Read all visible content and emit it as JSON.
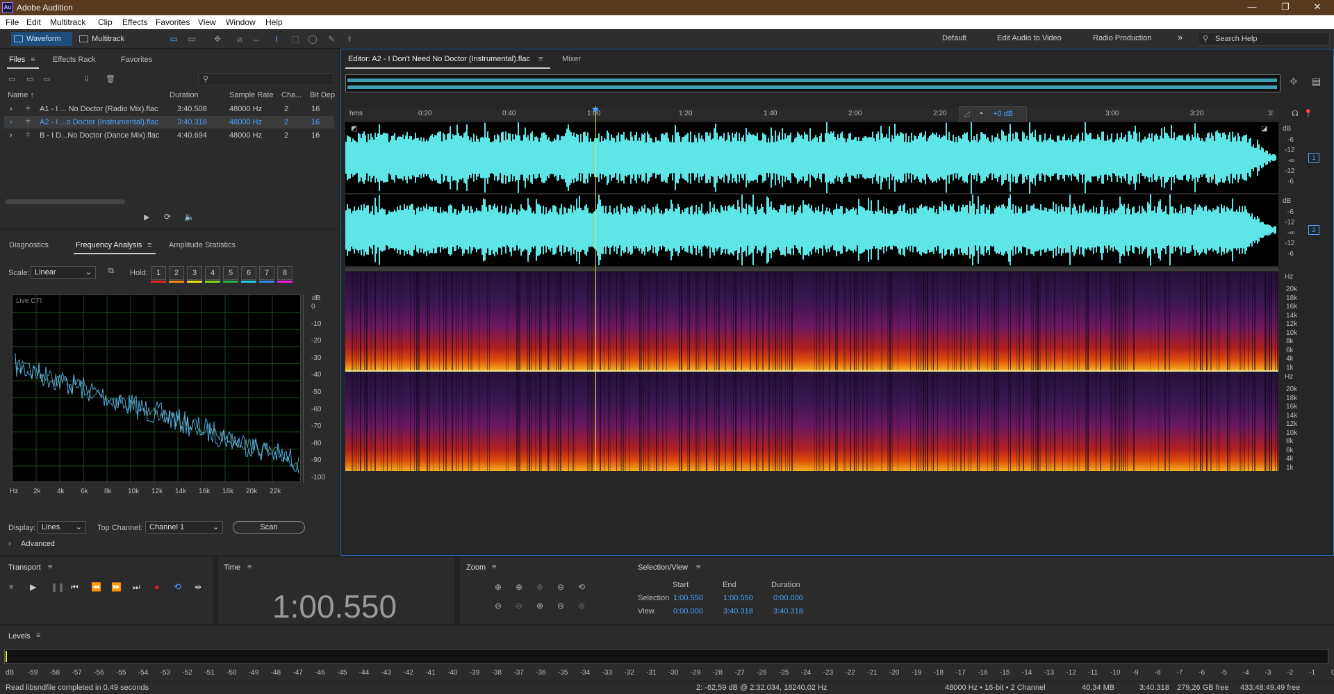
{
  "window": {
    "app_badge": "Au",
    "title": "Adobe Audition",
    "minimize": "—",
    "maximize": "❐",
    "close": "✕"
  },
  "menu": [
    "File",
    "Edit",
    "Multitrack",
    "Clip",
    "Effects",
    "Favorites",
    "View",
    "Window",
    "Help"
  ],
  "toolbar": {
    "waveform": "Waveform",
    "multitrack": "Multitrack",
    "workspaces": [
      "Default",
      "Edit Audio to Video",
      "Radio Production"
    ],
    "more": "»",
    "search_placeholder": "Search Help"
  },
  "files_panel": {
    "tabs": [
      "Files",
      "Effects Rack",
      "Favorites"
    ],
    "columns": [
      "Name ↑",
      "Duration",
      "Sample Rate",
      "Cha...",
      "Bit Dep"
    ],
    "rows": [
      {
        "name": "A1 - I ... No Doctor (Radio Mix).flac",
        "duration": "3:40.508",
        "rate": "48000 Hz",
        "ch": "2",
        "bits": "16"
      },
      {
        "name": "A2 - I ...o Doctor (Instrumental).flac",
        "duration": "3:40.318",
        "rate": "48000 Hz",
        "ch": "2",
        "bits": "16"
      },
      {
        "name": "B - I D...No Doctor (Dance Mix).flac",
        "duration": "4:40.694",
        "rate": "48000 Hz",
        "ch": "2",
        "bits": "16"
      }
    ]
  },
  "analysis_panel": {
    "tabs": [
      "Diagnostics",
      "Frequency Analysis",
      "Amplitude Statistics"
    ],
    "scale_label": "Scale:",
    "scale_value": "Linear",
    "hold_label": "Hold:",
    "hold_buttons": [
      "1",
      "2",
      "3",
      "4",
      "5",
      "6",
      "7",
      "8"
    ],
    "hold_colors": [
      "#e02424",
      "#f08a1a",
      "#e8e01a",
      "#8ad21e",
      "#22b14c",
      "#22c7e8",
      "#2a8cf0",
      "#e81ee0"
    ],
    "plot_label": "Live CTI",
    "db_unit": "dB",
    "db_ticks": [
      "0",
      "-10",
      "-20",
      "-30",
      "-40",
      "-50",
      "-60",
      "-70",
      "-80",
      "-90",
      "-100"
    ],
    "hz_ticks": [
      "Hz",
      "2k",
      "4k",
      "6k",
      "8k",
      "10k",
      "12k",
      "14k",
      "16k",
      "18k",
      "20k",
      "22k"
    ],
    "display_label": "Display:",
    "display_value": "Lines",
    "top_channel_label": "Top Channel:",
    "top_channel_value": "Channel 1",
    "scan_button": "Scan",
    "advanced": "Advanced"
  },
  "editor": {
    "tab": "Editor: A2 - I Don't Need No Doctor (Instrumental).flac",
    "mixer_tab": "Mixer",
    "time_ruler": [
      "hms",
      "0:20",
      "0:40",
      "1:00",
      "1:20",
      "1:40",
      "2:00",
      "2:20",
      "3:00",
      "3:20",
      "3:"
    ],
    "gain": "+0 dB",
    "db_unit": "dB",
    "wave_db_ticks": [
      "-6",
      "-12",
      "-∞",
      "-12",
      "-6"
    ],
    "channel_badges": [
      "1",
      "2"
    ],
    "hz_unit": "Hz",
    "spec_hz_ticks": [
      "20k",
      "18k",
      "16k",
      "14k",
      "12k",
      "10k",
      "8k",
      "6k",
      "4k",
      "1k"
    ]
  },
  "transport": {
    "title": "Transport"
  },
  "time_panel": {
    "title": "Time",
    "value": "1:00.550"
  },
  "zoom_panel": {
    "title": "Zoom"
  },
  "selection_view": {
    "title": "Selection/View",
    "headers": [
      "Start",
      "End",
      "Duration"
    ],
    "selection_label": "Selection",
    "selection": [
      "1:00.550",
      "1:00.550",
      "0:00.000"
    ],
    "view_label": "View",
    "view": [
      "0:00.000",
      "3:40.318",
      "3:40.318"
    ]
  },
  "levels": {
    "title": "Levels",
    "ticks": [
      "dB",
      "-59",
      "-58",
      "-57",
      "-56",
      "-55",
      "-54",
      "-53",
      "-52",
      "-51",
      "-50",
      "-49",
      "-48",
      "-47",
      "-46",
      "-45",
      "-44",
      "-43",
      "-42",
      "-41",
      "-40",
      "-39",
      "-38",
      "-37",
      "-36",
      "-35",
      "-34",
      "-33",
      "-32",
      "-31",
      "-30",
      "-29",
      "-28",
      "-27",
      "-26",
      "-25",
      "-24",
      "-23",
      "-22",
      "-21",
      "-20",
      "-19",
      "-18",
      "-17",
      "-16",
      "-15",
      "-14",
      "-13",
      "-12",
      "-11",
      "-10",
      "-9",
      "-8",
      "-7",
      "-6",
      "-5",
      "-4",
      "-3",
      "-2",
      "-1",
      "0"
    ]
  },
  "status": {
    "message": "Read libsndfile completed in 0,49 seconds",
    "cursor_info": "2: -62,59 dB @ 2:32.034, 18240,02 Hz",
    "format": "48000 Hz • 16-bit • 2 Channel",
    "size": "40,34 MB",
    "duration": "3:40.318",
    "free_space": "279,26 GB free",
    "free_time": "433:48:49.49 free"
  }
}
